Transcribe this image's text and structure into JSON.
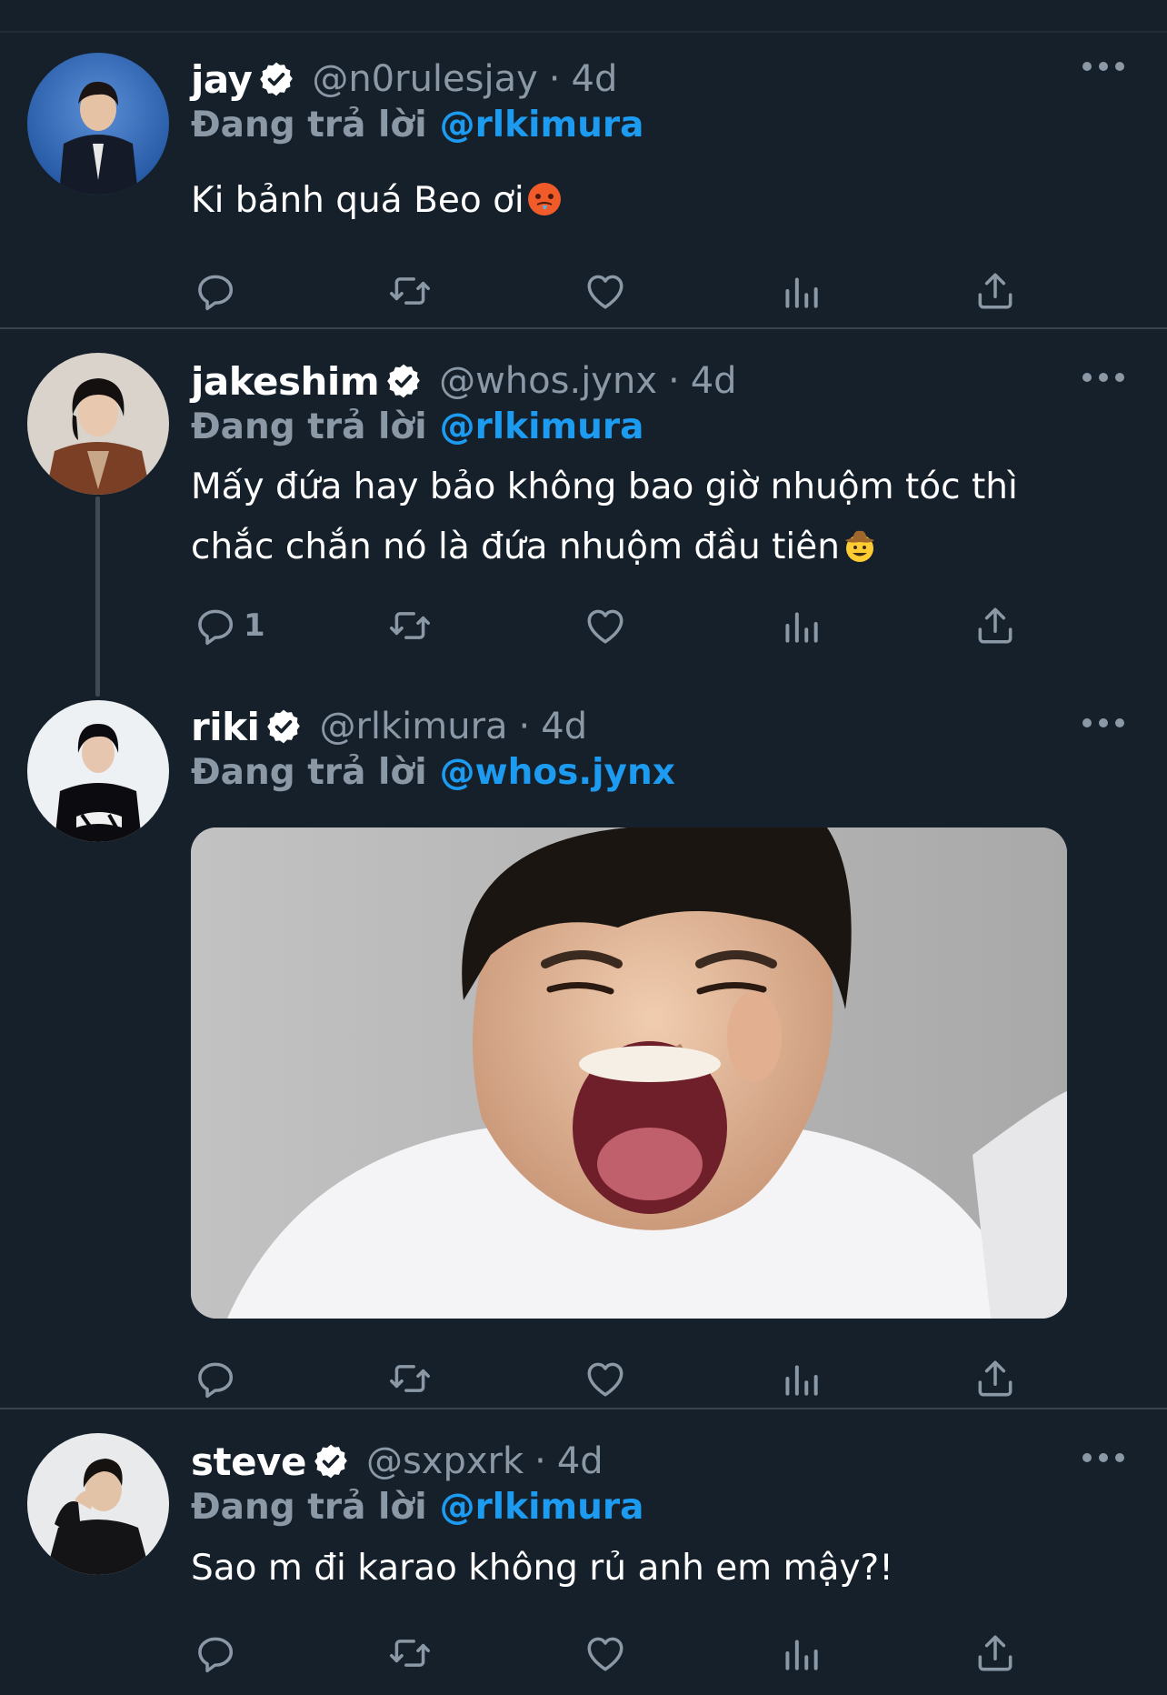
{
  "theme": {
    "bg": "#15202b",
    "muted": "#8b98a5",
    "accent": "#1d9bf0",
    "divider": "#38444d"
  },
  "tweets": [
    {
      "name": "jay",
      "handle": "@n0rulesjay",
      "dot": "·",
      "time": "4d",
      "reply_prefix": "Đang trả lời",
      "reply_to": "@rlkimura",
      "text": "Ki bảnh quá Beo ơi",
      "emoji": "hot-face-emoji",
      "reply_count": "",
      "has_media": false
    },
    {
      "name": "jakeshim",
      "handle": "@whos.jynx",
      "dot": "·",
      "time": "4d",
      "reply_prefix": "Đang trả lời",
      "reply_to": "@rlkimura",
      "text": "Mấy đứa hay bảo không bao giờ nhuộm tóc thì chắc chắn nó là đứa nhuộm đầu tiên",
      "emoji": "cowboy-face-emoji",
      "reply_count": "1",
      "has_media": false
    },
    {
      "name": "riki",
      "handle": "@rlkimura",
      "dot": "·",
      "time": "4d",
      "reply_prefix": "Đang trả lời",
      "reply_to": "@whos.jynx",
      "text": "",
      "reply_count": "",
      "has_media": true,
      "media_description": "photo-of-laughing-person"
    },
    {
      "name": "steve",
      "handle": "@sxpxrk",
      "dot": "·",
      "time": "4d",
      "reply_prefix": "Đang trả lời",
      "reply_to": "@rlkimura",
      "text": "Sao m đi karao không rủ anh em mậy?!",
      "reply_count": "",
      "has_media": false
    }
  ],
  "icons": [
    "reply-icon",
    "retweet-icon",
    "like-icon",
    "analytics-icon",
    "share-icon",
    "more-icon",
    "verified-icon"
  ]
}
